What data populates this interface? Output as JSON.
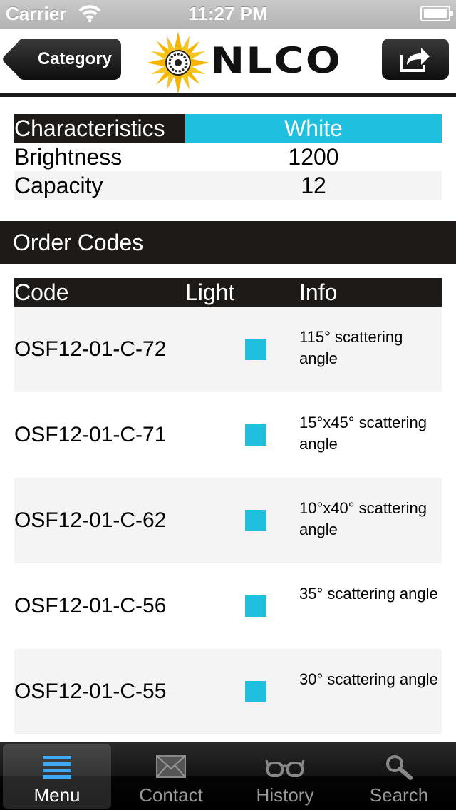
{
  "status_bar": {
    "carrier": "Carrier",
    "time": "11:27 PM",
    "wifi_icon": "wifi-icon",
    "battery_icon": "battery-icon"
  },
  "nav_bar": {
    "back_label": "Category",
    "logo_text": "NLCO",
    "logo_icon": "sun-logo-icon",
    "share_icon": "share-icon"
  },
  "characteristics": {
    "header_label": "Characteristics",
    "header_value": "White",
    "rows": [
      {
        "label": "Brightness",
        "value": "1200"
      },
      {
        "label": "Capacity",
        "value": "12"
      }
    ]
  },
  "order_codes": {
    "section_title": "Order Codes",
    "columns": {
      "code": "Code",
      "light": "Light",
      "info": "Info"
    },
    "rows": [
      {
        "code": "OSF12-01-C-72",
        "info": "115° scattering angle"
      },
      {
        "code": "OSF12-01-C-71",
        "info": "15°x45° scattering angle"
      },
      {
        "code": "OSF12-01-C-62",
        "info": "10°x40° scattering angle"
      },
      {
        "code": "OSF12-01-C-56",
        "info": "35° scattering angle"
      },
      {
        "code": "OSF12-01-C-55",
        "info": "30° scattering angle"
      }
    ]
  },
  "tab_bar": {
    "tabs": [
      {
        "label": "Menu",
        "icon": "menu-icon",
        "selected": true
      },
      {
        "label": "Contact",
        "icon": "envelope-icon",
        "selected": false
      },
      {
        "label": "History",
        "icon": "glasses-icon",
        "selected": false
      },
      {
        "label": "Search",
        "icon": "search-icon",
        "selected": false
      }
    ]
  },
  "colors": {
    "accent": "#1fbfe0",
    "dark": "#1e1a18",
    "light_swatch": "#1fbfe0"
  }
}
